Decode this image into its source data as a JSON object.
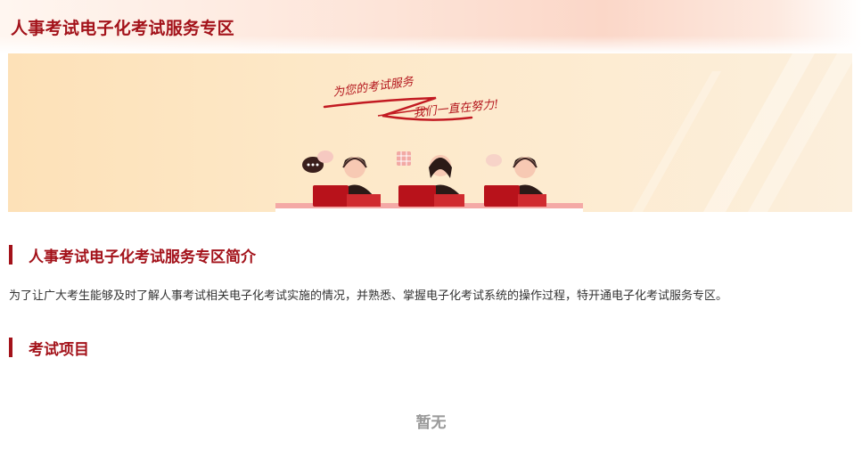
{
  "header": {
    "title": "人事考试电子化考试服务专区"
  },
  "banner": {
    "slogan_line1": "为您的考试服务",
    "slogan_line2": "我们一直在努力!",
    "colors": {
      "accent": "#a3121a",
      "desk": "#b8121b",
      "background": "#fde8c7"
    }
  },
  "sections": {
    "intro": {
      "title": "人事考试电子化考试服务专区简介",
      "text": "为了让广大考生能够及时了解人事考试相关电子化考试实施的情况，并熟悉、掌握电子化考试系统的操作过程，特开通电子化考试服务专区。"
    },
    "exams": {
      "title": "考试项目",
      "empty_text": "暂无"
    }
  }
}
